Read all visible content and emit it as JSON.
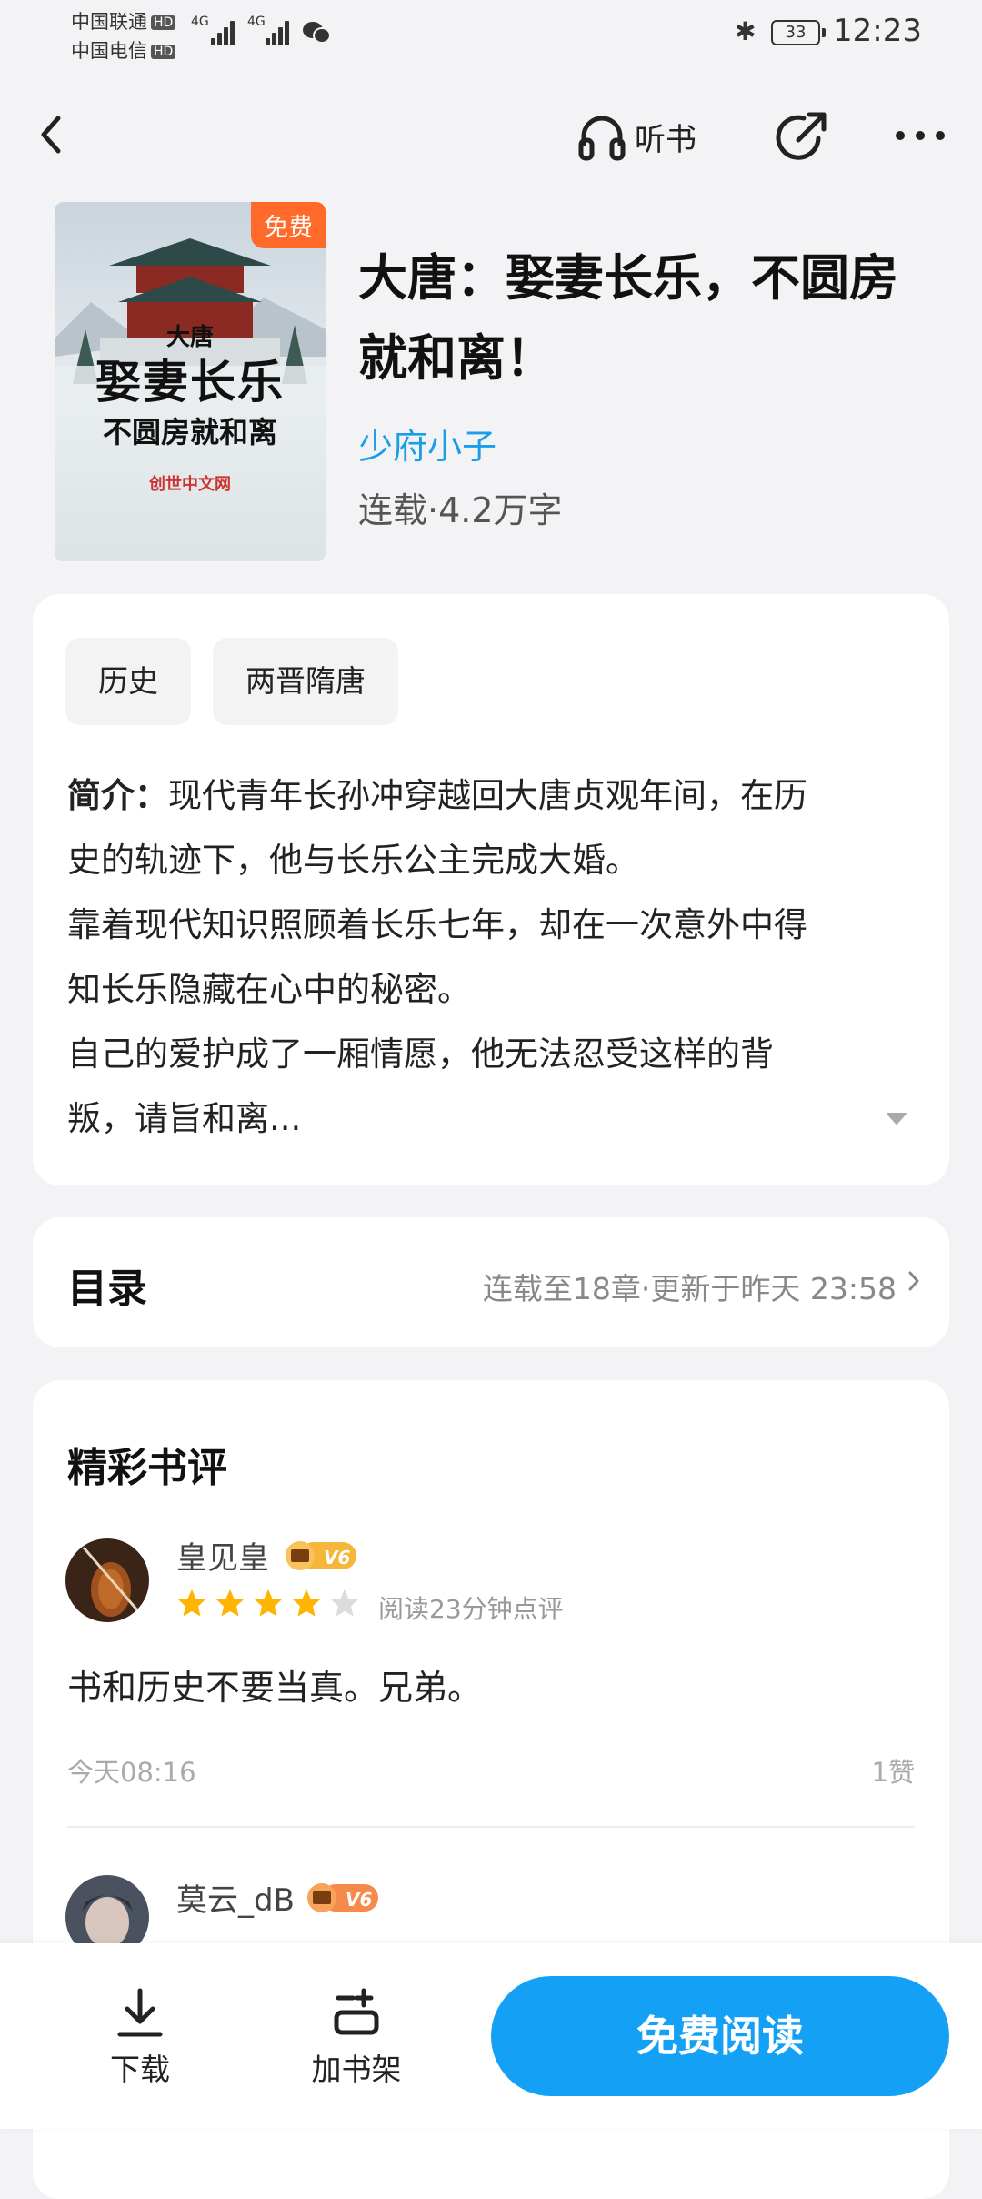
{
  "status_bar": {
    "carrier1": "中国联通",
    "carrier2": "中国电信",
    "hd_label": "HD",
    "network1": "4G",
    "network2": "4G",
    "battery": "33",
    "time": "12:23"
  },
  "nav": {
    "listen_label": "听书",
    "icons": [
      "back-icon",
      "headphones-icon",
      "share-icon",
      "more-icon"
    ]
  },
  "book": {
    "free_badge": "免费",
    "title": "大唐：娶妻长乐，不圆房就和离！",
    "author": "少府小子",
    "meta": "连载·4.2万字",
    "cover": {
      "small_title": "大唐",
      "main_title": "娶妻长乐",
      "subtitle": "不圆房就和离",
      "publisher": "创世中文网"
    }
  },
  "intro": {
    "tags": [
      "历史",
      "两晋隋唐"
    ],
    "label": "简介：",
    "lines": [
      "现代青年长孙冲穿越回大唐贞观年间，在历",
      "史的轨迹下，他与长乐公主完成大婚。",
      "靠着现代知识照顾着长乐七年，却在一次意外中得",
      "知长乐隐藏在心中的秘密。",
      "自己的爱护成了一厢情愿，他无法忍受这样的背",
      "叛，请旨和离..."
    ]
  },
  "toc": {
    "title": "目录",
    "status": "连载至18章·更新于昨天 23:58"
  },
  "reviews": {
    "title": "精彩书评",
    "items": [
      {
        "user": "皇见皇",
        "level": "V6",
        "rating": 4,
        "rating_max": 5,
        "read_time": "阅读23分钟点评",
        "text": "书和历史不要当真。兄弟。",
        "date": "今天08:16",
        "likes": "1赞"
      },
      {
        "user": "莫云_dB",
        "level": "V6"
      }
    ]
  },
  "bottom_bar": {
    "download_label": "下载",
    "shelf_label": "加书架",
    "read_label": "免费阅读"
  },
  "colors": {
    "accent": "#14a1f5",
    "author": "#1a9ee8",
    "badge": "#ff6a2a",
    "star": "#ffb400"
  }
}
